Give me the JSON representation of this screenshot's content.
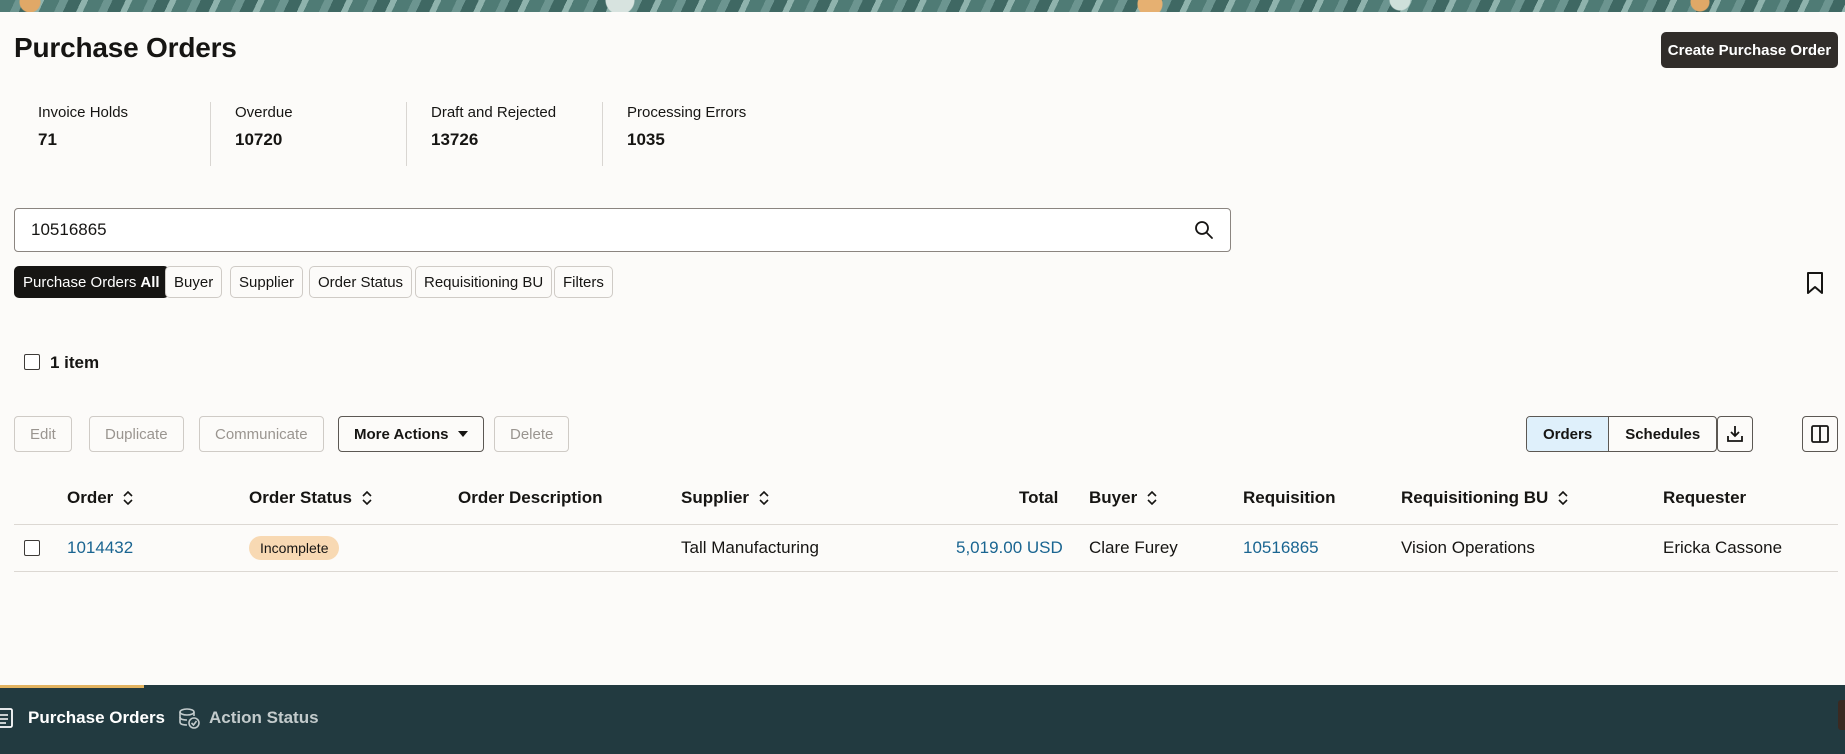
{
  "header": {
    "title": "Purchase Orders",
    "create_button": "Create Purchase Order"
  },
  "metrics": [
    {
      "label": "Invoice Holds",
      "value": "71"
    },
    {
      "label": "Overdue",
      "value": "10720"
    },
    {
      "label": "Draft and Rejected",
      "value": "13726"
    },
    {
      "label": "Processing Errors",
      "value": "1035"
    }
  ],
  "search": {
    "value": "10516865"
  },
  "chips": {
    "active_prefix": "Purchase Orders",
    "active_suffix": "All",
    "buyer": "Buyer",
    "supplier": "Supplier",
    "order_status": "Order Status",
    "requisitioning_bu": "Requisitioning BU",
    "filters": "Filters"
  },
  "selection": {
    "count_label": "1 item"
  },
  "toolbar": {
    "edit": "Edit",
    "duplicate": "Duplicate",
    "communicate": "Communicate",
    "more_actions": "More Actions",
    "delete": "Delete",
    "orders": "Orders",
    "schedules": "Schedules"
  },
  "table": {
    "columns": {
      "order": "Order",
      "order_status": "Order Status",
      "order_description": "Order Description",
      "supplier": "Supplier",
      "total": "Total",
      "buyer": "Buyer",
      "requisition": "Requisition",
      "requisitioning_bu": "Requisitioning BU",
      "requester": "Requester"
    },
    "rows": [
      {
        "order": "1014432",
        "order_status": "Incomplete",
        "order_description": "",
        "supplier": "Tall Manufacturing",
        "total": "5,019.00 USD",
        "buyer": "Clare Furey",
        "requisition": "10516865",
        "requisitioning_bu": "Vision Operations",
        "requester": "Ericka Cassone"
      }
    ]
  },
  "bottom_nav": {
    "tabs": [
      {
        "label": "Purchase Orders",
        "icon": "document-icon",
        "active": true
      },
      {
        "label": "Action Status",
        "icon": "database-status-icon",
        "active": false
      }
    ]
  },
  "colors": {
    "primary_dark": "#312d2a",
    "link": "#1a6591",
    "badge_incomplete": "#f8d9b3",
    "bottom_bar": "#223a40",
    "accent": "#e3b360",
    "segment_selected": "#dff0fb"
  }
}
